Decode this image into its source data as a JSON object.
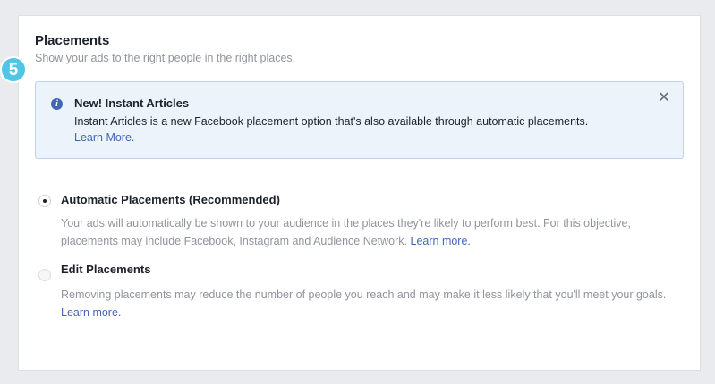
{
  "placements": {
    "title": "Placements",
    "subtitle": "Show your ads to the right people in the right places."
  },
  "step_badge": "5",
  "notice": {
    "icon": "info-icon",
    "title": "New! Instant Articles",
    "body": "Instant Articles is a new Facebook placement option that's also available through automatic placements.",
    "link": "Learn More.",
    "close_symbol": "✕"
  },
  "options": [
    {
      "label": "Automatic Placements (Recommended)",
      "selected": true,
      "description": "Your ads will automatically be shown to your audience in the places they're likely to perform best. For this objective, placements may include Facebook, Instagram and Audience Network.",
      "link": "Learn more."
    },
    {
      "label": "Edit Placements",
      "selected": false,
      "description": "Removing placements may reduce the number of people you reach and may make it less likely that you'll meet your goals.",
      "link": "Learn more."
    }
  ],
  "colors": {
    "link": "#4267b2",
    "badge": "#4fc6e6",
    "notice_bg": "#ecf3fb",
    "notice_border": "#bdd3eb",
    "muted_text": "#90949c"
  }
}
